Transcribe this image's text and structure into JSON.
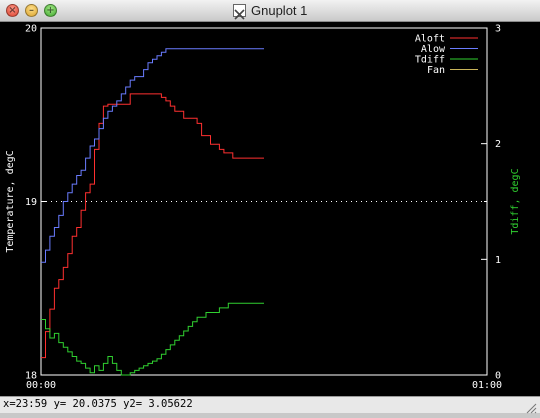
{
  "window": {
    "title": "Gnuplot 1"
  },
  "status": {
    "text": "x=23:59 y= 20.0375 y2= 3.05622"
  },
  "colors": {
    "background": "#000000",
    "foreground": "#ffffff",
    "aloft": "#ff3030",
    "alow": "#6a7cff",
    "tdiff": "#30d030",
    "fan": "#c8b45a",
    "y2label": "#30d030"
  },
  "icons": {
    "close": "close-icon",
    "minimize": "minimize-icon",
    "zoom": "zoom-icon",
    "x11": "x11-icon",
    "grip": "resize-grip-icon"
  },
  "chart_data": {
    "type": "line",
    "title": "",
    "xlabel": "",
    "ylabel": "Temperature, degC",
    "y2label": "Tdiff, degC",
    "xlim": [
      0,
      60
    ],
    "xticks": [
      "00:00",
      "01:00"
    ],
    "ylim": [
      18,
      20
    ],
    "yticks": [
      "18",
      "19",
      "20"
    ],
    "y2lim": [
      0,
      3
    ],
    "y2ticks": [
      "0",
      "1",
      "2",
      "3"
    ],
    "reference_line": {
      "axis": "y",
      "value": 19,
      "style": "dotted"
    },
    "legend": {
      "placement": "top-right",
      "entries": [
        "Aloft",
        "Alow",
        "Tdiff",
        "Fan"
      ]
    },
    "series": [
      {
        "name": "Aloft",
        "axis": "y",
        "x": [
          0,
          0.6,
          1.2,
          1.8,
          2.4,
          3,
          3.6,
          4.2,
          4.8,
          5.4,
          6,
          6.6,
          7.2,
          7.8,
          8.4,
          9,
          9.6,
          10.2,
          10.8,
          11.4,
          12,
          12.6,
          13.2,
          13.8,
          14.4,
          15,
          15.6,
          16.2,
          16.8,
          17.4,
          18,
          18.6,
          19.2,
          19.8,
          20.4,
          21,
          21.6,
          22.2,
          22.8,
          23.4,
          24,
          24.6,
          25.2,
          25.8,
          26.4,
          27,
          27.6,
          28.2,
          28.8,
          29.4,
          30
        ],
        "values": [
          18.1,
          18.25,
          18.38,
          18.5,
          18.55,
          18.62,
          18.7,
          18.8,
          18.85,
          18.95,
          19.05,
          19.1,
          19.3,
          19.45,
          19.55,
          19.56,
          19.56,
          19.56,
          19.56,
          19.56,
          19.62,
          19.62,
          19.62,
          19.62,
          19.62,
          19.62,
          19.62,
          19.6,
          19.58,
          19.55,
          19.52,
          19.52,
          19.48,
          19.48,
          19.48,
          19.45,
          19.38,
          19.38,
          19.33,
          19.33,
          19.3,
          19.28,
          19.28,
          19.25,
          19.25,
          19.25,
          19.25,
          19.25,
          19.25,
          19.25,
          19.25
        ]
      },
      {
        "name": "Alow",
        "axis": "y",
        "x": [
          0,
          0.6,
          1.2,
          1.8,
          2.4,
          3,
          3.6,
          4.2,
          4.8,
          5.4,
          6,
          6.6,
          7.2,
          7.8,
          8.4,
          9,
          9.6,
          10.2,
          10.8,
          11.4,
          12,
          12.6,
          13.2,
          13.8,
          14.4,
          15,
          15.6,
          16.2,
          16.8,
          17.4,
          18,
          18.6,
          19.2,
          19.8,
          20.4,
          21,
          21.6,
          22.2,
          22.8,
          23.4,
          24,
          24.6,
          25.2,
          25.8,
          26.4,
          27,
          27.6,
          28.2,
          28.8,
          29.4,
          30
        ],
        "values": [
          18.65,
          18.72,
          18.8,
          18.85,
          18.92,
          19.0,
          19.05,
          19.1,
          19.15,
          19.18,
          19.25,
          19.32,
          19.36,
          19.42,
          19.48,
          19.52,
          19.55,
          19.58,
          19.62,
          19.66,
          19.7,
          19.72,
          19.72,
          19.76,
          19.8,
          19.82,
          19.84,
          19.86,
          19.88,
          19.88,
          19.88,
          19.88,
          19.88,
          19.88,
          19.88,
          19.88,
          19.88,
          19.88,
          19.88,
          19.88,
          19.88,
          19.88,
          19.88,
          19.88,
          19.88,
          19.88,
          19.88,
          19.88,
          19.88,
          19.88,
          19.88
        ]
      },
      {
        "name": "Tdiff",
        "axis": "y2",
        "x": [
          0,
          0.6,
          1.2,
          1.8,
          2.4,
          3,
          3.6,
          4.2,
          4.8,
          5.4,
          6,
          6.6,
          7.2,
          7.8,
          8.4,
          9,
          9.6,
          10.2,
          10.8,
          11.4,
          12,
          12.6,
          13.2,
          13.8,
          14.4,
          15,
          15.6,
          16.2,
          16.8,
          17.4,
          18,
          18.6,
          19.2,
          19.8,
          20.4,
          21,
          21.6,
          22.2,
          22.8,
          23.4,
          24,
          24.6,
          25.2,
          25.8,
          26.4,
          27,
          27.6,
          28.2,
          28.8,
          29.4,
          30
        ],
        "values": [
          0.48,
          0.4,
          0.32,
          0.36,
          0.28,
          0.24,
          0.2,
          0.16,
          0.12,
          0.1,
          0.06,
          0.02,
          0.08,
          0.04,
          0.1,
          0.16,
          0.1,
          0.04,
          0.0,
          0.0,
          0.02,
          0.04,
          0.06,
          0.08,
          0.1,
          0.12,
          0.14,
          0.18,
          0.22,
          0.26,
          0.3,
          0.34,
          0.38,
          0.42,
          0.46,
          0.5,
          0.5,
          0.54,
          0.54,
          0.54,
          0.58,
          0.58,
          0.62,
          0.62,
          0.62,
          0.62,
          0.62,
          0.62,
          0.62,
          0.62,
          0.62
        ]
      },
      {
        "name": "Fan",
        "axis": "y2",
        "x": [],
        "values": []
      }
    ]
  }
}
